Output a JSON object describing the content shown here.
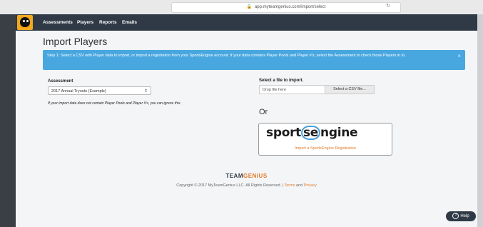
{
  "browser": {
    "url": "app.myteamgenius.com/import/select"
  },
  "nav": {
    "items": [
      "Assessments",
      "Players",
      "Reports",
      "Emails"
    ]
  },
  "page": {
    "title": "Import Players",
    "alert": "Step 1: Select a CSV with Player data to import, or import a registration from your SportsEngine account. If your data contains Player Pools and Player #'s, select the Assessment to check those Players in to.",
    "alert_close": "×"
  },
  "assessment": {
    "label": "Assessment",
    "selected": "2017 Annual Tryouts (Example)",
    "note": "If your import data does not contain Player Pools and Player #'s, you can ignore this."
  },
  "file": {
    "label": "Select a file to import.",
    "drop_text": "Drop file here",
    "select_button": "Select a CSV file..."
  },
  "or_text": "Or",
  "sportsengine": {
    "logo_prefix": "sport",
    "logo_ring": "se",
    "logo_suffix": "ngine",
    "link": "Import a SportsEngine Registration"
  },
  "footer": {
    "logo_main": "TEAM",
    "logo_accent": "GENIUS",
    "copyright": "Copyright © 2017 MyTeamGenius LLC. All Rights Reserved. |",
    "terms": "Terms",
    "and": "and",
    "privacy": "Privacy"
  },
  "help": {
    "label": "Help"
  },
  "colors": {
    "navbar": "#2f3a46",
    "alert": "#49a7e0",
    "brand_accent": "#e07b26",
    "logo_bg": "#f4a81d"
  }
}
